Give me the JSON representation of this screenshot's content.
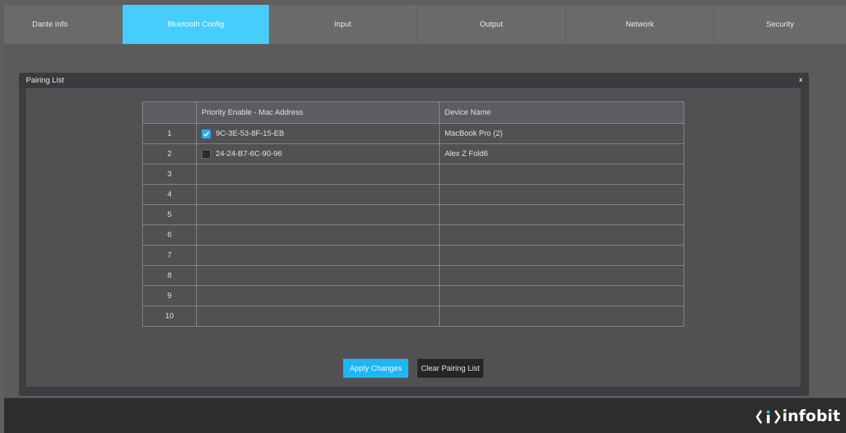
{
  "nav": {
    "tabs": [
      {
        "label": "Dante Info",
        "active": false
      },
      {
        "label": "Bluetooth Config",
        "active": true
      },
      {
        "label": "Input",
        "active": false
      },
      {
        "label": "Output",
        "active": false
      },
      {
        "label": "Network",
        "active": false
      },
      {
        "label": "Security",
        "active": false
      }
    ]
  },
  "modal": {
    "title": "Pairing List",
    "close_label": "x",
    "table": {
      "headers": [
        "",
        "Priority Enable - Mac Address",
        "Device Name"
      ],
      "rows": [
        {
          "index": "1",
          "priority_enabled": true,
          "mac": "9C-3E-53-8F-15-EB",
          "device": "MacBook Pro (2)"
        },
        {
          "index": "2",
          "priority_enabled": false,
          "mac": "24-24-B7-6C-90-96",
          "device": "Alex Z Fold6"
        },
        {
          "index": "3",
          "mac": "",
          "device": ""
        },
        {
          "index": "4",
          "mac": "",
          "device": ""
        },
        {
          "index": "5",
          "mac": "",
          "device": ""
        },
        {
          "index": "6",
          "mac": "",
          "device": ""
        },
        {
          "index": "7",
          "mac": "",
          "device": ""
        },
        {
          "index": "8",
          "mac": "",
          "device": ""
        },
        {
          "index": "9",
          "mac": "",
          "device": ""
        },
        {
          "index": "10",
          "mac": "",
          "device": ""
        }
      ]
    },
    "buttons": {
      "apply": "Apply Changes",
      "clear": "Clear Pairing List"
    }
  },
  "footer": {
    "logo_text": "infobit",
    "logo_icon": "infobit-logo-icon"
  },
  "colors": {
    "accent": "#46cdfc",
    "apply_button": "#1eb7f4",
    "checkbox_on": "#2fa8ec"
  }
}
